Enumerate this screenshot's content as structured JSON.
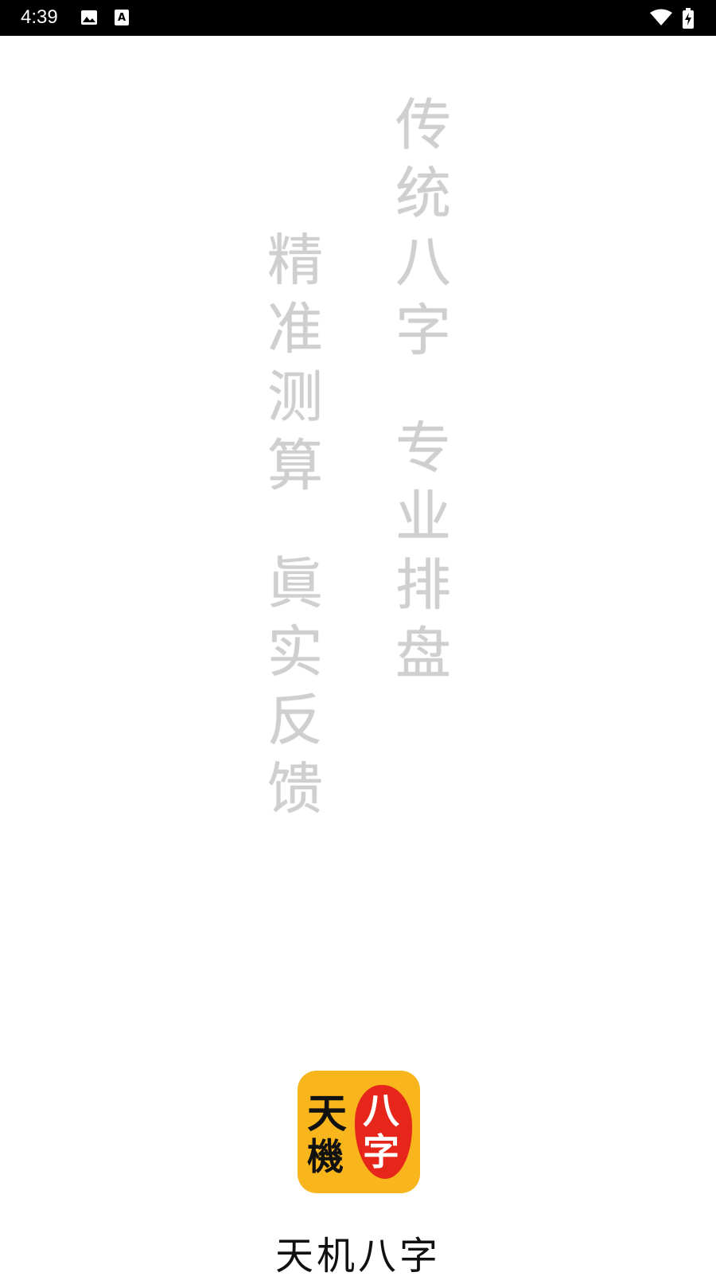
{
  "status_bar": {
    "time": "4:39",
    "icons": [
      "image-icon",
      "accessibility-a-icon",
      "wifi-icon",
      "battery-charging-icon"
    ]
  },
  "splash": {
    "column_right": {
      "line1": [
        "传",
        "统",
        "八",
        "字"
      ],
      "line2": [
        "专",
        "业",
        "排",
        "盘"
      ]
    },
    "column_left": {
      "line1": [
        "精",
        "准",
        "测",
        "算"
      ],
      "line2": [
        "眞",
        "实",
        "反",
        "馈"
      ]
    },
    "text_color": "#cfcfcf"
  },
  "logo": {
    "left_chars": [
      "天",
      "機"
    ],
    "right_chars": [
      "八",
      "字"
    ],
    "background": "#f8b51c",
    "accent": "#e6261b"
  },
  "app_name": "天机八字"
}
